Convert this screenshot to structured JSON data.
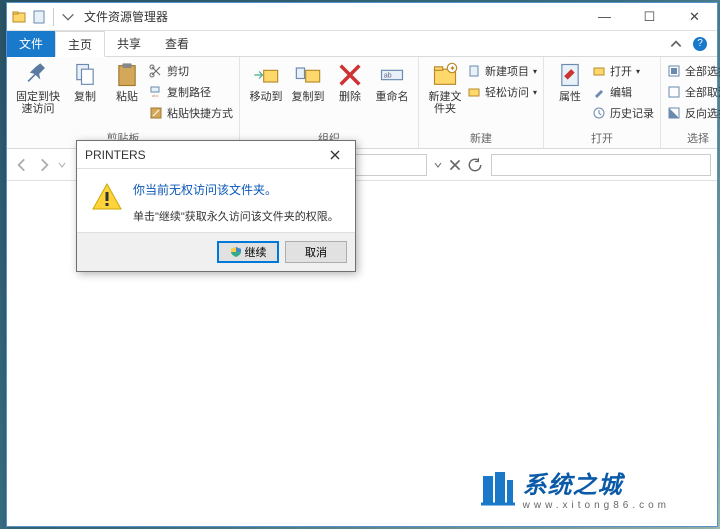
{
  "title": "文件资源管理器",
  "tabs": {
    "file": "文件",
    "home": "主页",
    "share": "共享",
    "view": "查看"
  },
  "ribbon": {
    "clipboard": {
      "label": "剪贴板",
      "pin": "固定到快速访问",
      "copy": "复制",
      "paste": "粘贴",
      "cut": "剪切",
      "copy_path": "复制路径",
      "paste_shortcut": "粘贴快捷方式"
    },
    "organize": {
      "label": "组织",
      "move_to": "移动到",
      "copy_to": "复制到",
      "delete": "删除",
      "rename": "重命名"
    },
    "new": {
      "label": "新建",
      "new_folder": "新建文件夹",
      "new_item": "新建项目",
      "easy_access": "轻松访问"
    },
    "open": {
      "label": "打开",
      "properties": "属性",
      "open": "打开",
      "edit": "编辑",
      "history": "历史记录"
    },
    "select": {
      "label": "选择",
      "select_all": "全部选择",
      "select_none": "全部取消",
      "invert": "反向选择"
    }
  },
  "dialog": {
    "title": "PRINTERS",
    "message": "你当前无权访问该文件夹。",
    "sub": "单击\"继续\"获取永久访问该文件夹的权限。",
    "continue": "继续",
    "cancel": "取消"
  },
  "watermark": {
    "main": "系统之城",
    "sub": "www.xitong86.com"
  }
}
